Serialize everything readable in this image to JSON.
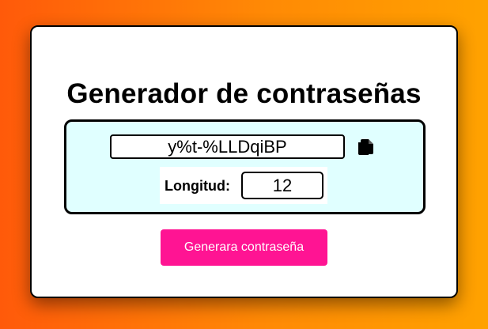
{
  "title": "Generador de contraseñas",
  "password": {
    "value": "y%t-%LLDqiBP"
  },
  "copy_icon": "copy-icon",
  "length": {
    "label": "Longitud:",
    "value": "12"
  },
  "generate_button": {
    "label": "Generara contraseña",
    "color": "#ff1493"
  },
  "colors": {
    "panel_background": "#e0ffff",
    "background_gradient_start": "#ff5a0a",
    "background_gradient_end": "#ffa200"
  }
}
